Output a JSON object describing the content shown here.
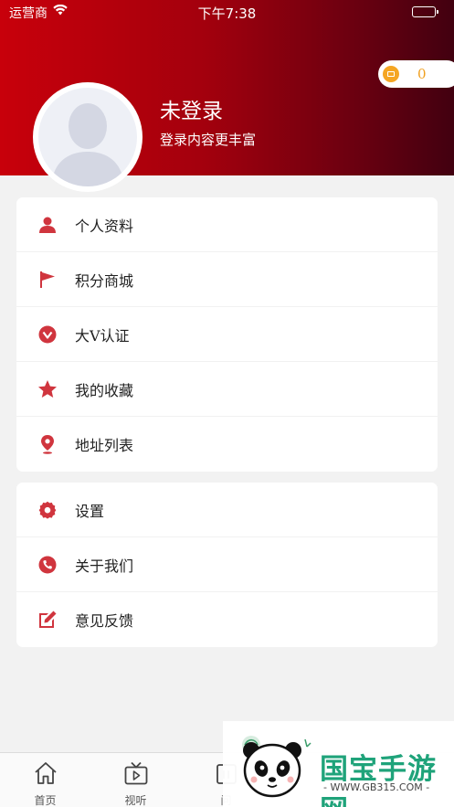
{
  "status_bar": {
    "carrier": "运营商",
    "time": "下午7:38"
  },
  "points": {
    "value": "0",
    "icon": "coin-icon"
  },
  "profile": {
    "username": "未登录",
    "subtitle": "登录内容更丰富",
    "avatar_icon": "default-avatar-icon"
  },
  "colors": {
    "brand_red": "#c8000b",
    "menu_icon": "#d0353e",
    "points_gold": "#f5a623"
  },
  "menu_group_1": [
    {
      "label": "个人资料",
      "icon": "person-icon"
    },
    {
      "label": "积分商城",
      "icon": "flag-icon"
    },
    {
      "label": "大V认证",
      "icon": "verified-icon"
    },
    {
      "label": "我的收藏",
      "icon": "star-icon"
    },
    {
      "label": "地址列表",
      "icon": "location-pin-icon"
    }
  ],
  "menu_group_2": [
    {
      "label": "设置",
      "icon": "gear-icon"
    },
    {
      "label": "关于我们",
      "icon": "phone-icon"
    },
    {
      "label": "意见反馈",
      "icon": "edit-icon"
    }
  ],
  "tabbar": {
    "tabs": [
      {
        "label": "首页",
        "icon": "home-icon"
      },
      {
        "label": "视听",
        "icon": "tv-play-icon"
      },
      {
        "label": "问",
        "icon": "question-icon"
      }
    ]
  },
  "watermark": {
    "title": "国宝手游网",
    "url": "- WWW.GB315.COM -"
  }
}
